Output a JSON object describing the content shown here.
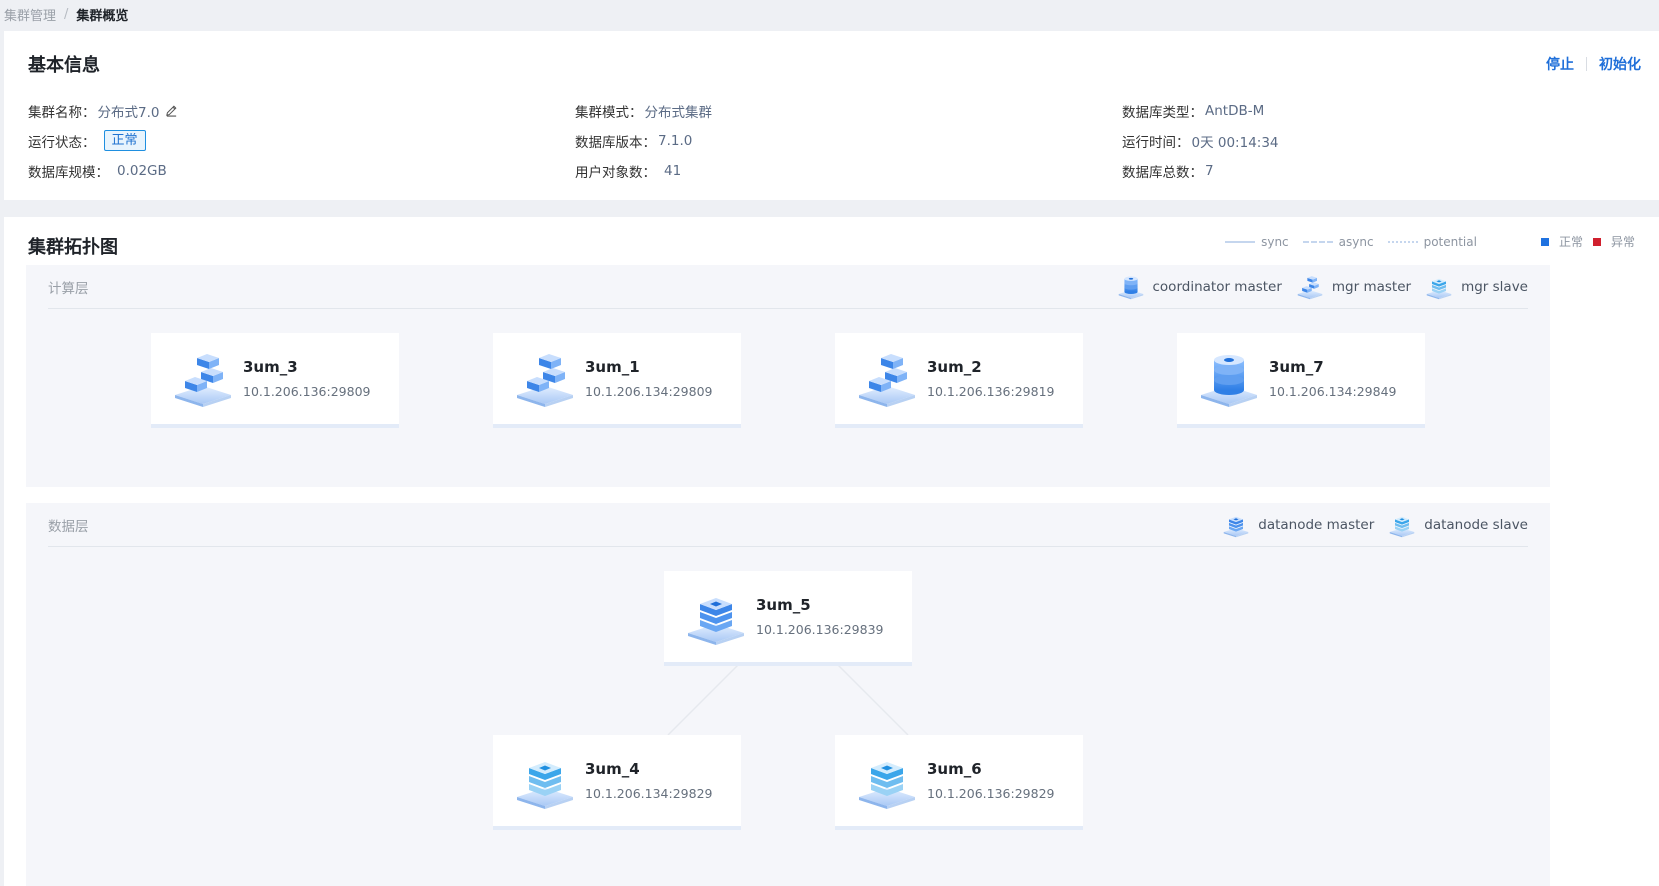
{
  "breadcrumb": {
    "parent": "集群管理",
    "separator": "/",
    "current": "集群概览"
  },
  "basic_info": {
    "title": "基本信息",
    "actions": {
      "stop": "停止",
      "init": "初始化"
    },
    "fields": {
      "cluster_name": {
        "label": "集群名称：",
        "value": "分布式7.0"
      },
      "cluster_mode": {
        "label": "集群模式：",
        "value": "分布式集群"
      },
      "db_type": {
        "label": "数据库类型：",
        "value": "AntDB-M"
      },
      "run_status": {
        "label": "运行状态：",
        "value": "正常"
      },
      "db_version": {
        "label": "数据库版本：",
        "value": "7.1.0"
      },
      "run_time": {
        "label": "运行时间：",
        "value": "0天 00:14:34"
      },
      "db_size": {
        "label": "数据库规模：",
        "value": "0.02GB"
      },
      "user_objects": {
        "label": "用户对象数：",
        "value": "41"
      },
      "db_total": {
        "label": "数据库总数：",
        "value": "7"
      }
    }
  },
  "topology": {
    "title": "集群拓扑图",
    "legend": {
      "sync": "sync",
      "async": "async",
      "potential": "potential",
      "normal": "正常",
      "abnormal": "异常"
    },
    "colors": {
      "normal": "#1f72e0",
      "abnormal": "#d0202e",
      "link": "#c5d6ee",
      "accent": "#1f6fd9"
    },
    "compute_layer": {
      "title": "计算层",
      "roles": {
        "coordinator_master": "coordinator master",
        "mgr_master": "mgr master",
        "mgr_slave": "mgr slave"
      },
      "nodes": [
        {
          "name": "3um_3",
          "addr": "10.1.206.136:29809",
          "icon": "mgr-master-icon"
        },
        {
          "name": "3um_1",
          "addr": "10.1.206.134:29809",
          "icon": "mgr-master-icon"
        },
        {
          "name": "3um_2",
          "addr": "10.1.206.136:29819",
          "icon": "mgr-master-icon"
        },
        {
          "name": "3um_7",
          "addr": "10.1.206.134:29849",
          "icon": "coordinator-master-icon"
        }
      ]
    },
    "data_layer": {
      "title": "数据层",
      "roles": {
        "datanode_master": "datanode master",
        "datanode_slave": "datanode slave"
      },
      "nodes": [
        {
          "name": "3um_5",
          "addr": "10.1.206.136:29839",
          "icon": "datanode-master-icon"
        },
        {
          "name": "3um_4",
          "addr": "10.1.206.134:29829",
          "icon": "datanode-slave-icon"
        },
        {
          "name": "3um_6",
          "addr": "10.1.206.136:29829",
          "icon": "datanode-slave-icon"
        }
      ]
    }
  }
}
